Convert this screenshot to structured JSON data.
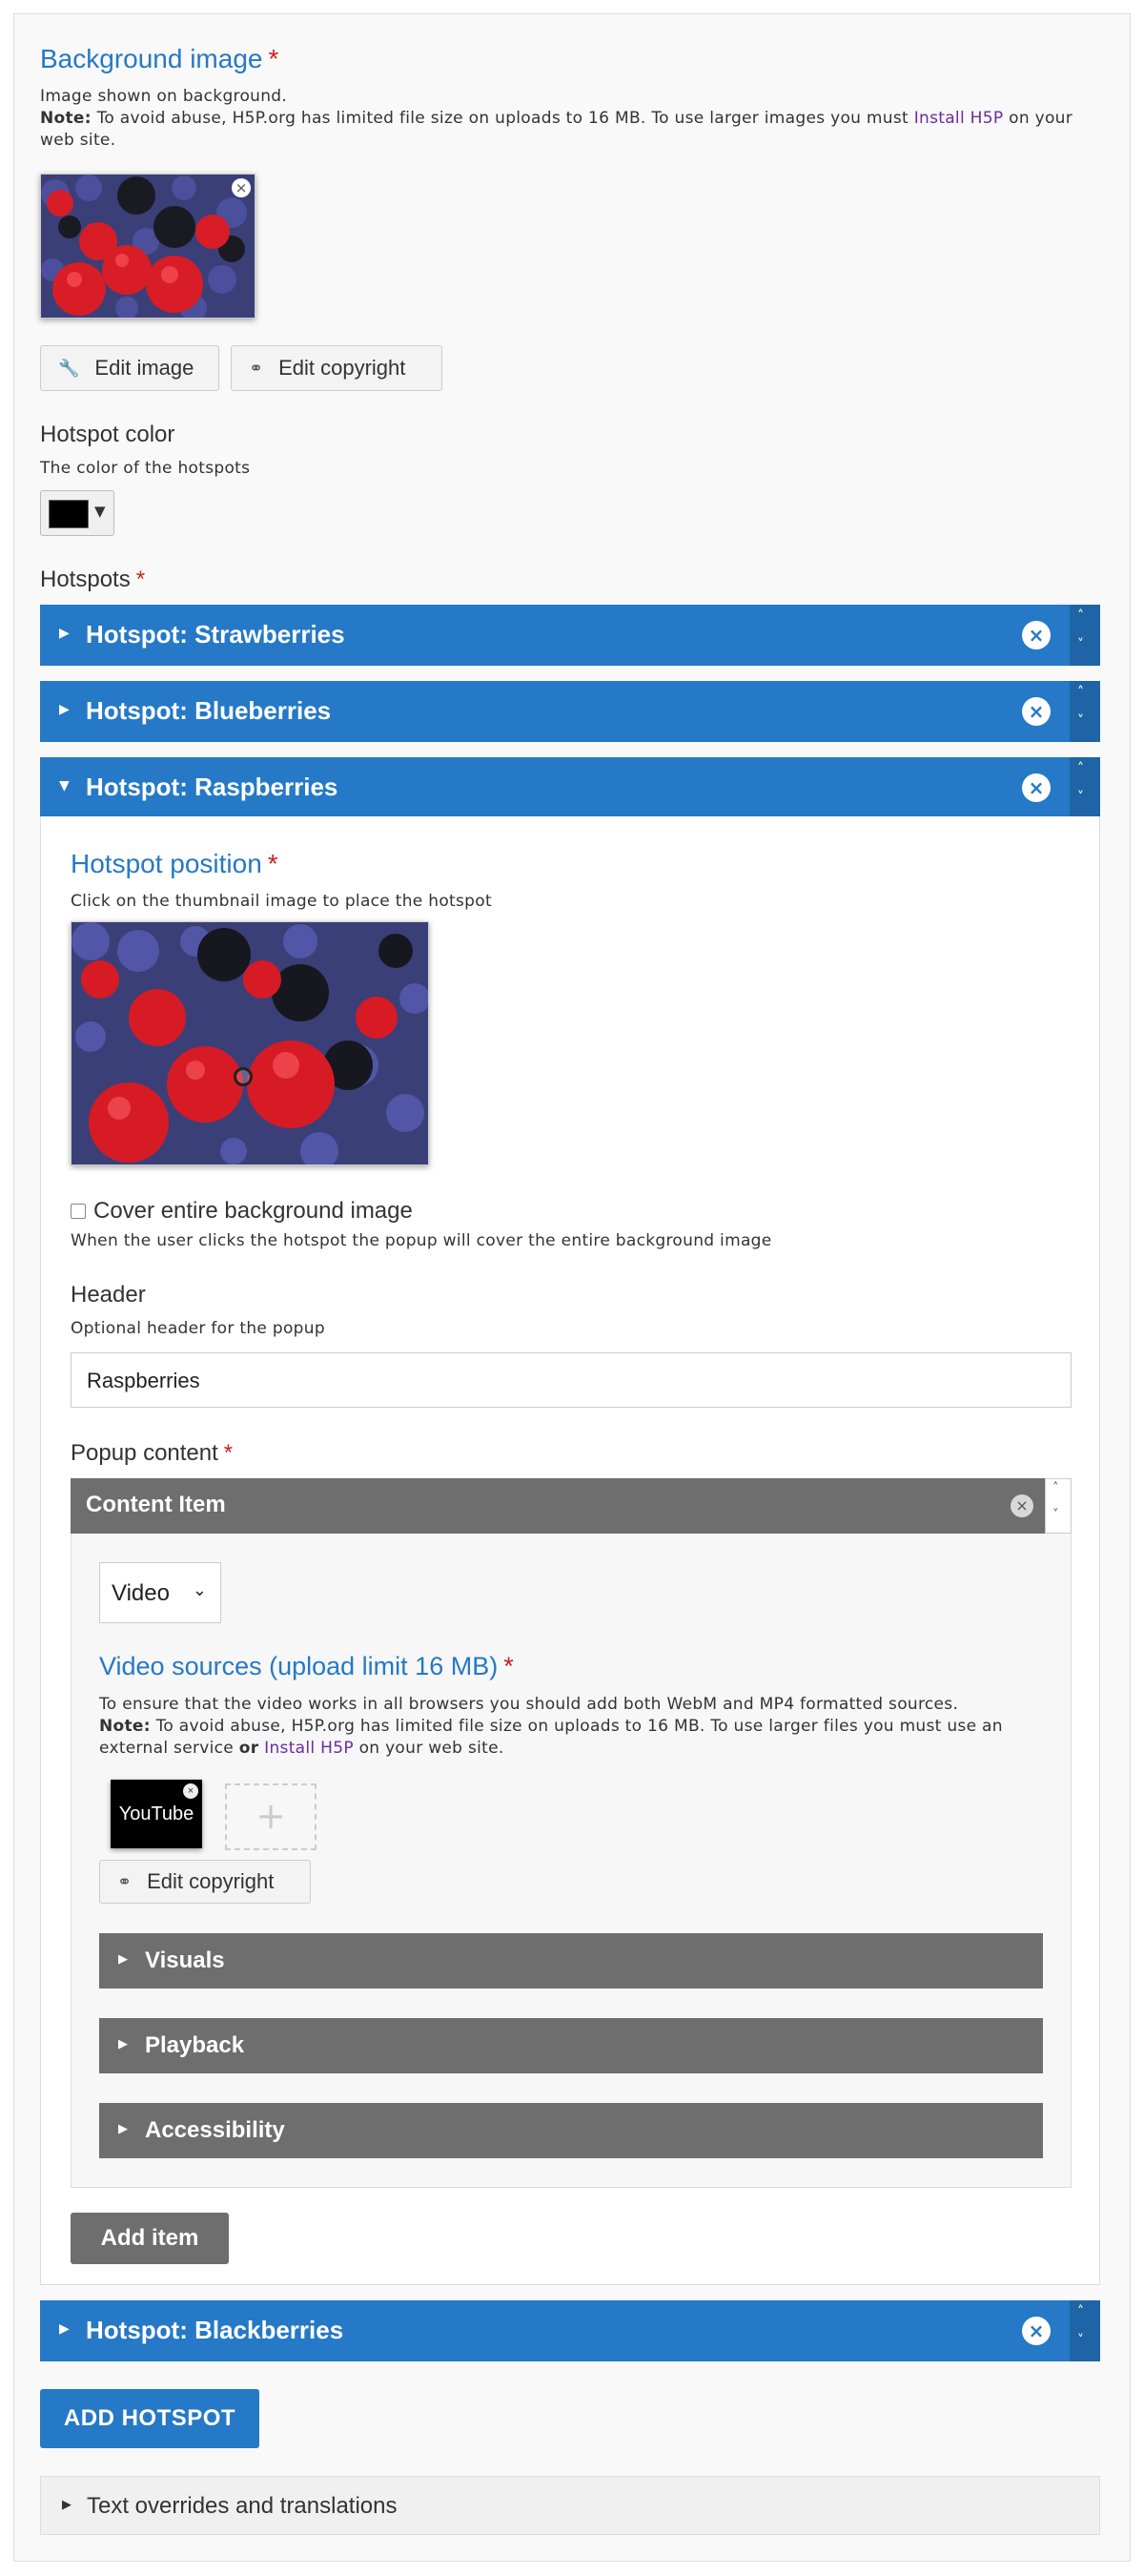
{
  "background_image": {
    "title": "Background image",
    "required": "*",
    "description": "Image shown on background.",
    "note_label": "Note:",
    "note_text": " To avoid abuse, H5P.org has limited file size on uploads to 16 MB. To use larger images you must ",
    "note_link": "Install H5P",
    "note_end": " on your web site.",
    "thumb_close": "×",
    "edit_image_label": "Edit image",
    "edit_copyright_label": "Edit copyright"
  },
  "hotspot_color": {
    "label": "Hotspot color",
    "description": "The color of the hotspots",
    "value": "#000000",
    "caret": "▼"
  },
  "hotspots": {
    "label": "Hotspots",
    "required": "*",
    "items": [
      {
        "title": "Hotspot: Strawberries",
        "expanded": false
      },
      {
        "title": "Hotspot: Blueberries",
        "expanded": false
      },
      {
        "title": "Hotspot: Raspberries",
        "expanded": true
      },
      {
        "title": "Hotspot: Blackberries",
        "expanded": false
      }
    ],
    "remove_glyph": "×",
    "up_glyph": "˄",
    "down_glyph": "˅"
  },
  "raspberries": {
    "position_title": "Hotspot position",
    "position_required": "*",
    "position_desc": "Click on the thumbnail image to place the hotspot",
    "cover_label": "Cover entire background image",
    "cover_checked": false,
    "cover_desc": "When the user clicks the hotspot the popup will cover the entire background image",
    "header_label": "Header",
    "header_desc": "Optional header for the popup",
    "header_value": "Raspberries",
    "popup_label": "Popup content",
    "popup_required": "*",
    "content_item_label": "Content Item",
    "content_type": "Video",
    "video_sources_title": "Video sources (upload limit 16 MB)",
    "video_sources_required": "*",
    "video_desc_1": "To ensure that the video works in all browsers you should add both WebM and MP4 formatted sources.",
    "video_note_label": "Note:",
    "video_note_text": " To avoid abuse, H5P.org has limited file size on uploads to 16 MB. To use larger files you must use an external service ",
    "video_note_or": "or",
    "video_note_link": "Install H5P",
    "video_note_end": " on your web site.",
    "youtube_label": "YouTube",
    "add_tile": "+",
    "edit_copyright_label": "Edit copyright",
    "sections": [
      "Visuals",
      "Playback",
      "Accessibility"
    ],
    "add_item_label": "Add item"
  },
  "add_hotspot_label": "ADD HOTSPOT",
  "text_overrides_label": "Text overrides and translations",
  "colors": {
    "accent": "#2579c6",
    "required": "#c9231d",
    "grey_bar": "#6e6e6e",
    "link": "#6b2aa3"
  }
}
